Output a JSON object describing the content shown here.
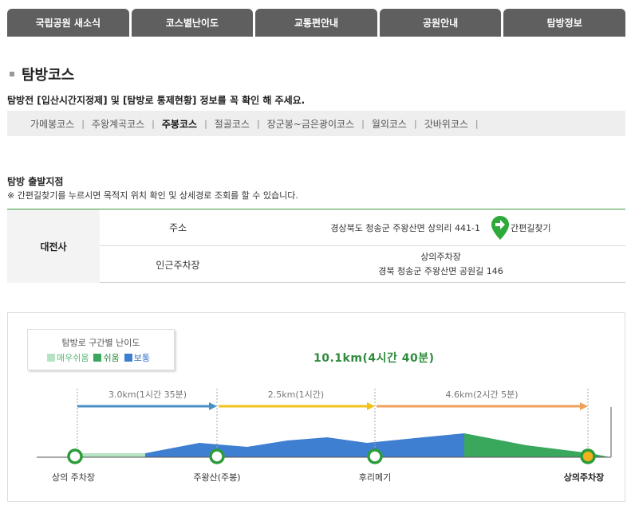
{
  "topnav": [
    "국립공원 새소식",
    "코스별난이도",
    "교통편안내",
    "공원안내",
    "탐방정보"
  ],
  "section_title": "탐방코스",
  "notice": "탐방전 [입산시간지정제] 및 [탐방로 통제현황] 정보를 꼭 확인 해 주세요.",
  "subnav": {
    "items": [
      "가메봉코스",
      "주왕계곡코스",
      "주봉코스",
      "절골코스",
      "장군봉~금은광이코스",
      "월외코스",
      "갓바위코스"
    ],
    "active": 2
  },
  "start": {
    "title": "탐방 출발지점",
    "desc": "※ 간편길찾기를 누르시면 목적지 위치 확인 및 상세경로 조회를 할 수 있습니다.",
    "place": "대전사",
    "address_label": "주소",
    "address": "경상북도 청송군 주왕산면 상의리 441-1",
    "find_label": "간편길찾기",
    "parking_label": "인근주차장",
    "parking_name": "상의주차장",
    "parking_address": "경북 청송군 주왕산면 공원길 146"
  },
  "route": {
    "legend_title": "탐방로 구간별 난이도",
    "legend": [
      {
        "label": "매우쉬움",
        "color": "#b5e3c4"
      },
      {
        "label": "쉬움",
        "color": "#3aa85c"
      },
      {
        "label": "보통",
        "color": "#3f7fd1"
      }
    ],
    "total": "10.1km(4시간 40분)",
    "segments": [
      {
        "label": "3.0km(1시간 35분)",
        "color": "#4a8fc4"
      },
      {
        "label": "2.5km(1시간)",
        "color": "#f2c21a"
      },
      {
        "label": "4.6km(2시간 5분)",
        "color": "#f0a05a"
      }
    ],
    "points": [
      "상의 주차장",
      "주왕산(주봉)",
      "후리메기",
      "상의주차장"
    ]
  }
}
